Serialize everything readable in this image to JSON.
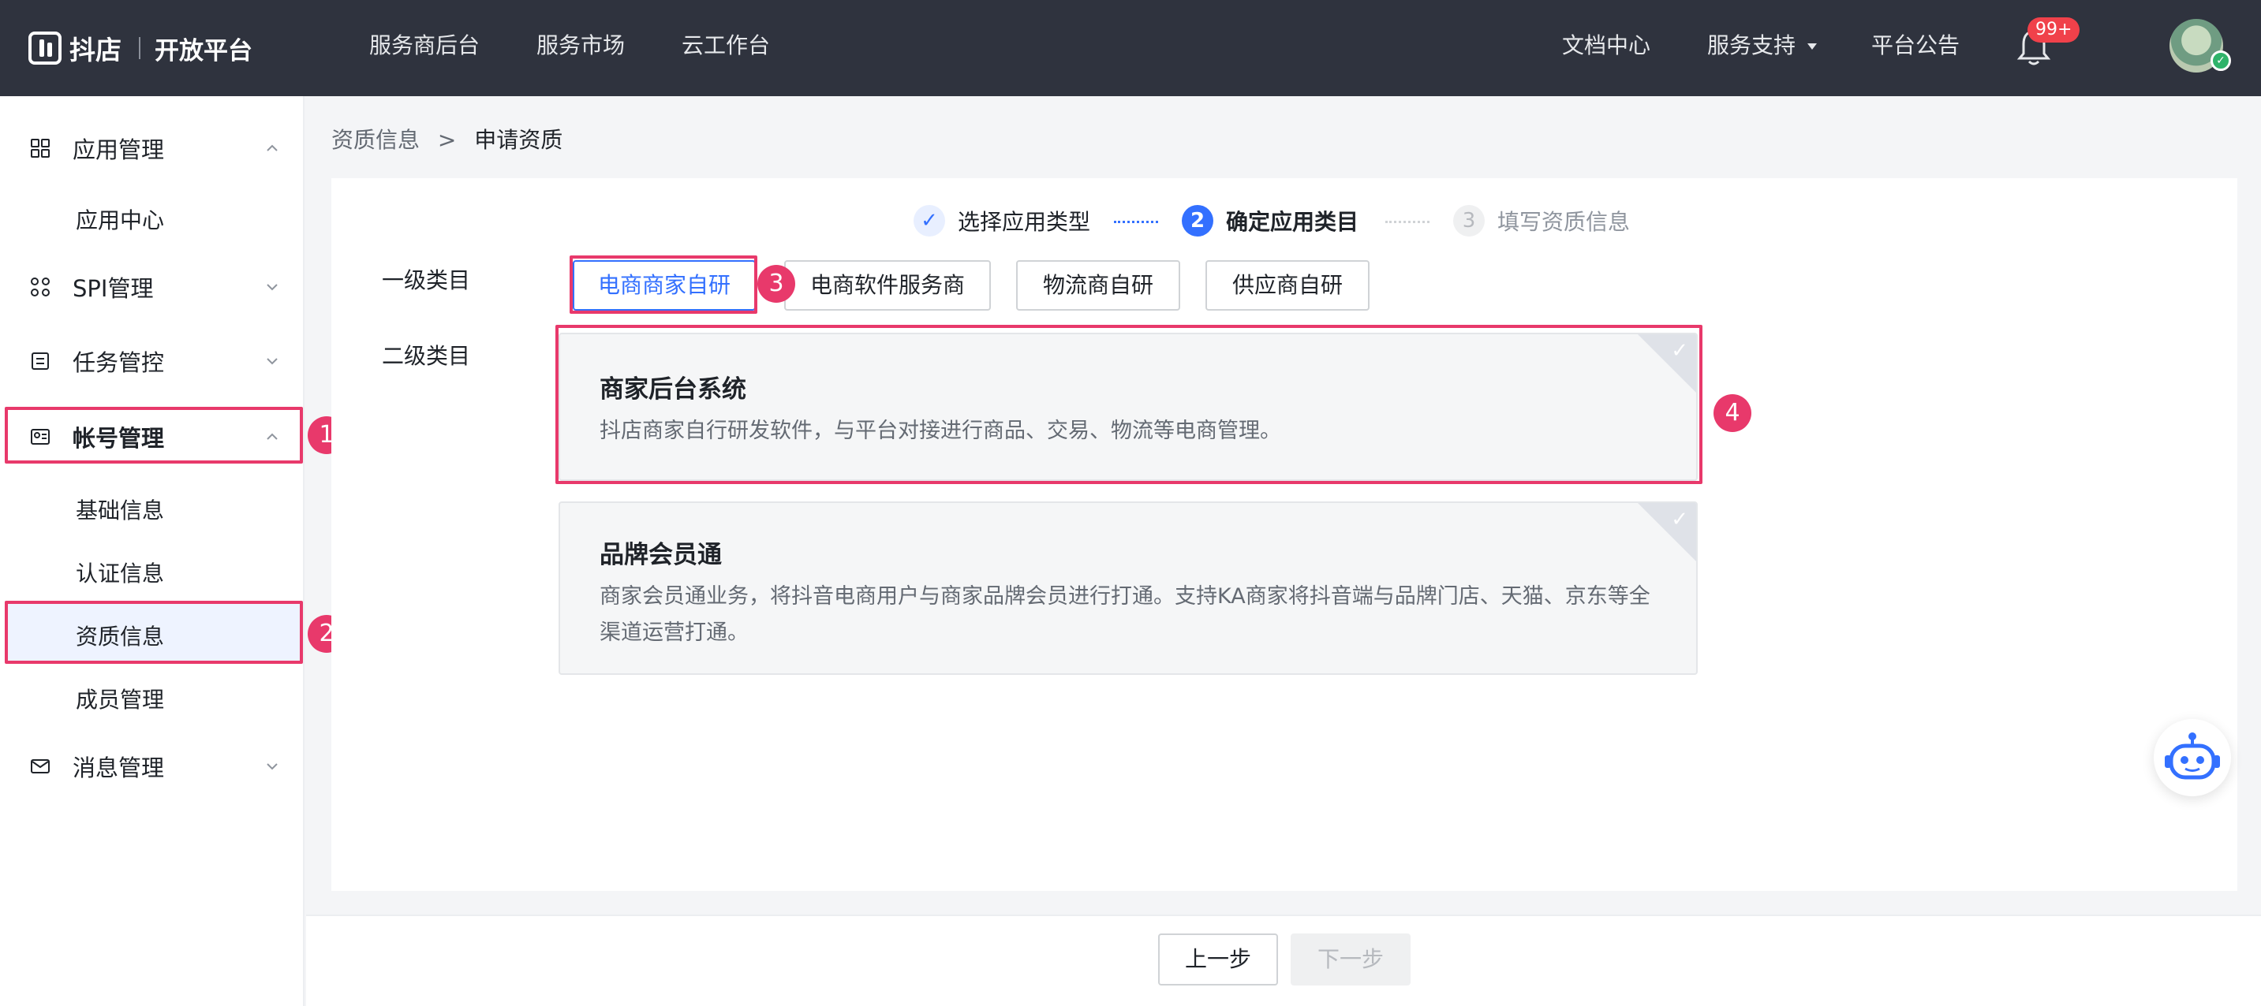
{
  "brand": {
    "name": "抖店",
    "subtitle": "开放平台"
  },
  "top_nav": {
    "left": [
      "服务商后台",
      "服务市场",
      "云工作台"
    ],
    "right": [
      "文档中心",
      "服务支持",
      "平台公告"
    ],
    "notification_badge": "99+"
  },
  "sidebar": {
    "groups": [
      {
        "label": "应用管理",
        "icon": "grid-icon",
        "expanded": true,
        "children": [
          "应用中心"
        ]
      },
      {
        "label": "SPI管理",
        "icon": "spi-icon",
        "expanded": false
      },
      {
        "label": "任务管控",
        "icon": "task-icon",
        "expanded": false
      },
      {
        "label": "帐号管理",
        "icon": "id-card-icon",
        "expanded": true,
        "children": [
          "基础信息",
          "认证信息",
          "资质信息",
          "成员管理"
        ]
      },
      {
        "label": "消息管理",
        "icon": "mail-icon",
        "expanded": false
      }
    ],
    "active_item": "资质信息"
  },
  "breadcrumb": {
    "parent": "资质信息",
    "separator": ">",
    "current": "申请资质"
  },
  "steps": [
    {
      "label": "选择应用类型",
      "state": "done",
      "marker": "✓"
    },
    {
      "label": "确定应用类目",
      "state": "current",
      "marker": "2"
    },
    {
      "label": "填写资质信息",
      "state": "todo",
      "marker": "3"
    }
  ],
  "form": {
    "level1_label": "一级类目",
    "level2_label": "二级类目",
    "level1_options": [
      "电商商家自研",
      "电商软件服务商",
      "物流商自研",
      "供应商自研"
    ],
    "level1_selected": "电商商家自研",
    "level2_cards": [
      {
        "title": "商家后台系统",
        "desc": "抖店商家自行研发软件，与平台对接进行商品、交易、物流等电商管理。"
      },
      {
        "title": "品牌会员通",
        "desc": "商家会员通业务，将抖音电商用户与商家品牌会员进行打通。支持KA商家将抖音端与品牌门店、天猫、京东等全渠道运营打通。"
      }
    ]
  },
  "footer": {
    "prev_label": "上一步",
    "next_label": "下一步"
  },
  "annotations": [
    "1",
    "2",
    "3",
    "4"
  ],
  "colors": {
    "topbar": "#2f333e",
    "accent": "#3370ff",
    "annotation": "#e8396b"
  }
}
